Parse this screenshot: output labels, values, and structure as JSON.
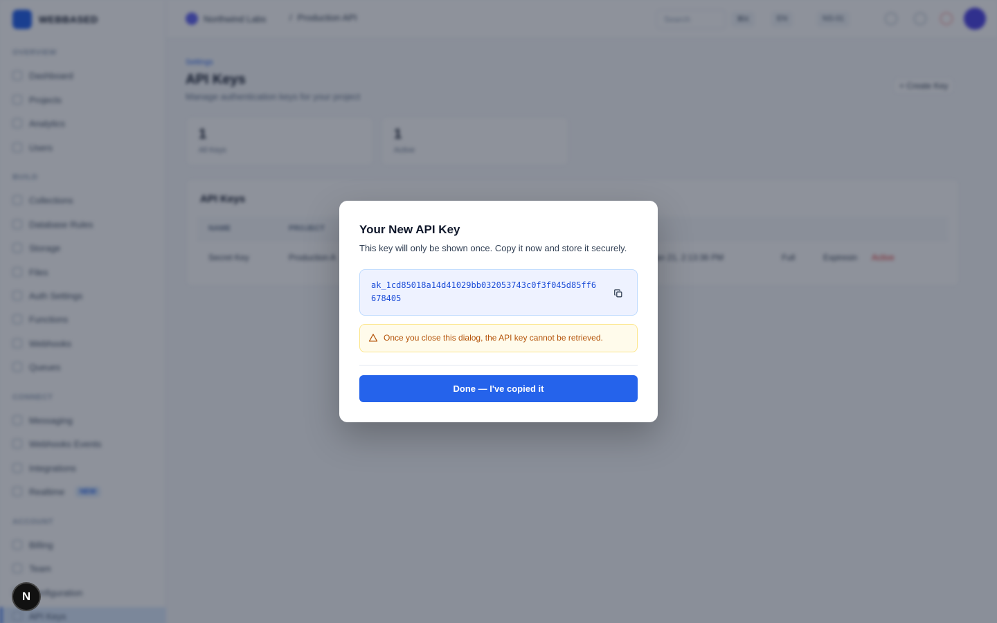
{
  "app": {
    "brand": "WEBBASED",
    "breadcrumb": {
      "org": "Northwind Labs",
      "project": "Production API"
    },
    "search_placeholder": "Search",
    "top_chips": [
      "⌘K",
      "EN",
      "NS-01"
    ],
    "sidebar": {
      "sections": [
        {
          "label": "Overview",
          "items": [
            "Dashboard",
            "Projects",
            "Analytics",
            "Users"
          ]
        },
        {
          "label": "Build",
          "items": [
            "Collections",
            "Database Rules",
            "Storage",
            "Files",
            "Auth Settings",
            "Functions",
            "Webhooks",
            "Queues"
          ]
        },
        {
          "label": "Connect",
          "items": [
            "Messaging",
            "Webhooks Events",
            "Integrations",
            "Realtime"
          ]
        },
        {
          "label": "Account",
          "items": [
            "Billing",
            "Team",
            "Configuration",
            "API Keys"
          ]
        }
      ],
      "realtime_badge": "NEW"
    },
    "page": {
      "back_link": "Settings",
      "title": "API Keys",
      "subtitle": "Manage authentication keys for your project",
      "create_button": "+ Create Key",
      "stats": [
        {
          "value": "1",
          "label": "All Keys"
        },
        {
          "value": "1",
          "label": "Active"
        }
      ],
      "table": {
        "title": "API Keys",
        "headers": [
          "NAME",
          "PROJECT",
          "",
          "",
          "",
          ""
        ],
        "row": [
          "Secret Key",
          "Production A",
          "Jan 21, 2:13:36 PM",
          "Full",
          "Expiresin",
          "Active"
        ]
      }
    },
    "dev_button": "N"
  },
  "dialog": {
    "title": "Your New API Key",
    "subtitle": "This key will only be shown once. Copy it now and store it securely.",
    "api_key": "ak_1cd85018a14d41029bb032053743c0f3f045d85ff6678405",
    "warning": "Once you close this dialog, the API key cannot be retrieved.",
    "done_button": "Done — I've copied it"
  },
  "colors": {
    "primary": "#2563eb",
    "warning_text": "#b45309",
    "warning_bg": "#fffbeb",
    "key_text": "#1d4ed8",
    "key_bg": "#eef2ff"
  }
}
